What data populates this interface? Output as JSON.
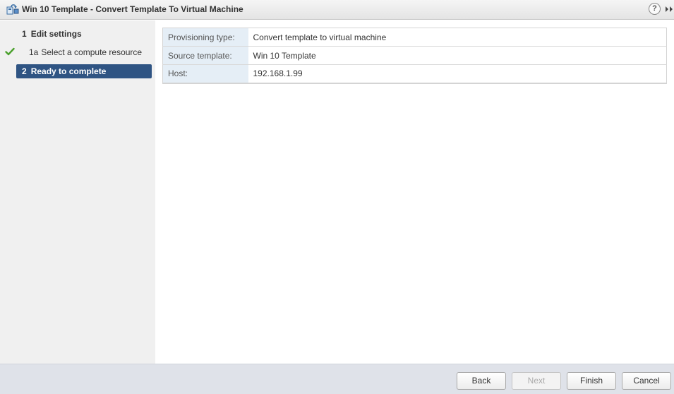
{
  "window": {
    "title": "Win 10 Template - Convert Template To Virtual Machine",
    "title_icon": "vm-template-convert-icon",
    "help_label": "?",
    "help_icon": "help-icon",
    "expand_icon": "double-chevron-right-icon"
  },
  "steps": [
    {
      "number": "1",
      "label": "Edit settings",
      "state": "section"
    },
    {
      "number": "1a",
      "label": "Select a compute resource",
      "state": "completed",
      "icon": "checkmark-icon"
    },
    {
      "number": "2",
      "label": "Ready to complete",
      "state": "current"
    }
  ],
  "summary": [
    {
      "key": "Provisioning type:",
      "value": "Convert template to virtual machine"
    },
    {
      "key": "Source template:",
      "value": "Win 10 Template"
    },
    {
      "key": "Host:",
      "value": "192.168.1.99"
    }
  ],
  "buttons": {
    "back": "Back",
    "next": "Next",
    "finish": "Finish",
    "cancel": "Cancel",
    "next_enabled": false
  },
  "colors": {
    "current_step_bg": "#2f5483",
    "checkmark": "#4aa02c",
    "summary_key_bg": "#e5eef6",
    "footer_bg": "#dfe2e9"
  }
}
